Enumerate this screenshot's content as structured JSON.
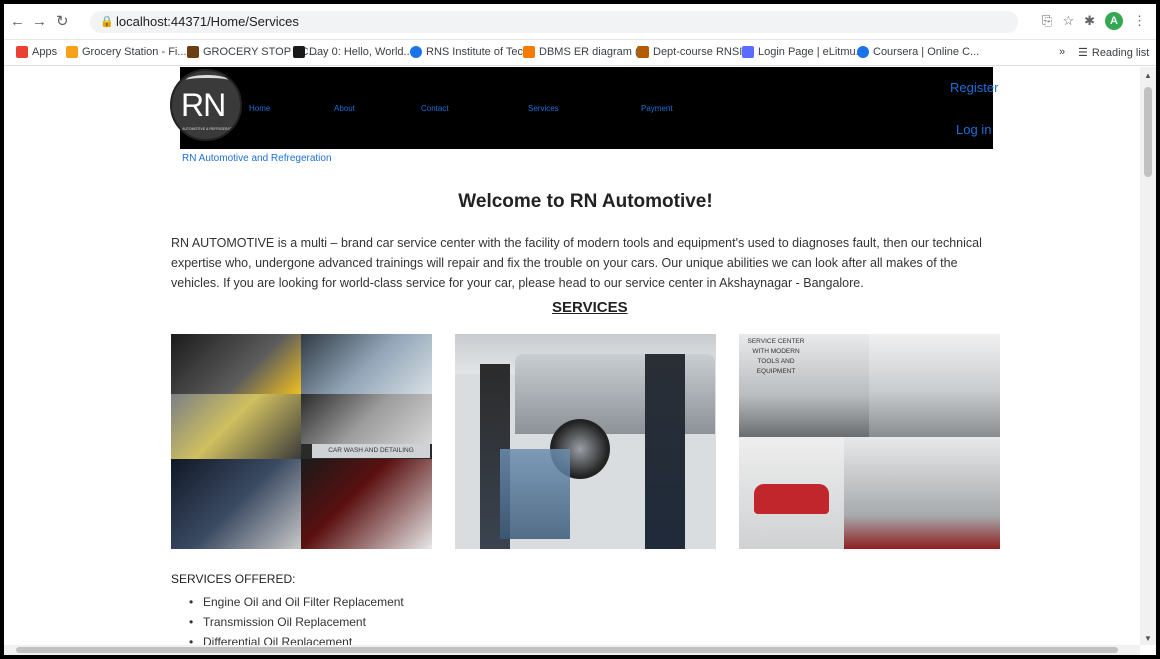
{
  "browser": {
    "url": "localhost:44371/Home/Services",
    "profile_initial": "A",
    "bookmarks": [
      {
        "label": "Apps",
        "color": "#e94235"
      },
      {
        "label": "Grocery Station - Fi...",
        "color": "#f6a21d"
      },
      {
        "label": "GROCERY STOP - C...",
        "color": "#6b3f14"
      },
      {
        "label": "Day 0: Hello, World....",
        "color": "#1a1a1a"
      },
      {
        "label": "RNS Institute of Tec...",
        "color": "#1a73e8"
      },
      {
        "label": "DBMS ER diagram (...",
        "color": "#f57c00"
      },
      {
        "label": "Dept-course RNSIT",
        "color": "#b35c00"
      },
      {
        "label": "Login Page | eLitmu...",
        "color": "#5a6cff"
      },
      {
        "label": "Coursera | Online C...",
        "color": "#1a73e8"
      }
    ],
    "overflow": "»",
    "reading_list": "Reading list"
  },
  "site": {
    "logo_text": "RN",
    "logo_subtitle": "AUTOMOTIVE & REFRIGERATION",
    "nav": [
      "Home",
      "About",
      "Contact",
      "Services",
      "Payment"
    ],
    "register": "Register",
    "login": "Log in",
    "brand": "RN Automotive and Refregeration",
    "welcome": "Welcome to RN Automotive!",
    "intro": "RN AUTOMOTIVE is a multi – brand car service center with the facility of modern tools and equipment's used to diagnoses fault, then our technical expertise who, undergone advanced trainings will repair and fix the trouble on your cars. Our unique abilities we can look after all makes of the vehicles. If you are looking for world-class service for your car, please head to our service center in Akshaynagar - Bangalore.",
    "services_heading": "SERVICES",
    "image_captions": {
      "car_wash": "CAR WASH AND DETAILING",
      "service_center": "SERVICE CENTER WITH MODERN TOOLS AND EQUIPMENT"
    },
    "services_offered_label": "SERVICES OFFERED:",
    "services_offered": [
      "Engine Oil and Oil Filter Replacement",
      "Transmission Oil Replacement",
      "Differential Oil Replacement"
    ]
  }
}
